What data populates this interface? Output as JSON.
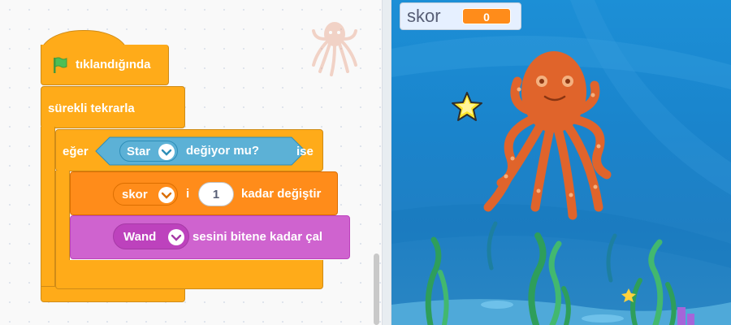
{
  "code": {
    "hat_label": "tıklandığında",
    "forever_label": "sürekli tekrarla",
    "if_label": "eğer",
    "then_label": "ise",
    "touching": {
      "target": "Star",
      "suffix": "değiyor mu?"
    },
    "change_var": {
      "variable": "skor",
      "connector": "i",
      "amount": "1",
      "suffix": "kadar değiştir"
    },
    "play_sound": {
      "sound": "Wand",
      "suffix": "sesini bitene kadar çal"
    }
  },
  "stage": {
    "monitor": {
      "label": "skor",
      "value": "0"
    }
  },
  "colors": {
    "events": "#ffab19",
    "control": "#ffab19",
    "sensing": "#5cb1d6",
    "variables": "#ff8c1a",
    "sound": "#cf63cf",
    "octopus": "#e0642b",
    "star": "#ffe629"
  },
  "icons": [
    "green-flag-icon",
    "dropdown-caret-icon",
    "octopus-sprite-icon",
    "star-sprite-icon"
  ]
}
